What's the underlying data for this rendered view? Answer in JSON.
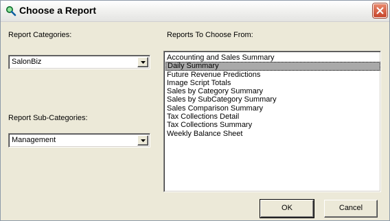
{
  "window": {
    "title": "Choose a Report"
  },
  "categories": {
    "label": "Report Categories:",
    "value": "SalonBiz"
  },
  "subcategories": {
    "label": "Report Sub-Categories:",
    "value": "Management"
  },
  "reports": {
    "label": "Reports To Choose From:",
    "items": [
      "Accounting and Sales Summary",
      "Daily Summary",
      "Future Revenue Predictions",
      "Image Script Totals",
      "Sales by Category Summary",
      "Sales by SubCategory Summary",
      "Sales Comparison Summary",
      "Tax Collections Detail",
      "Tax Collections Summary",
      "Weekly Balance Sheet"
    ],
    "selected": "Daily Summary"
  },
  "buttons": {
    "ok": "OK",
    "cancel": "Cancel"
  },
  "icons": {
    "title": "magnifier-icon",
    "close": "close-icon",
    "dropdown": "dropdown-arrow-icon"
  }
}
